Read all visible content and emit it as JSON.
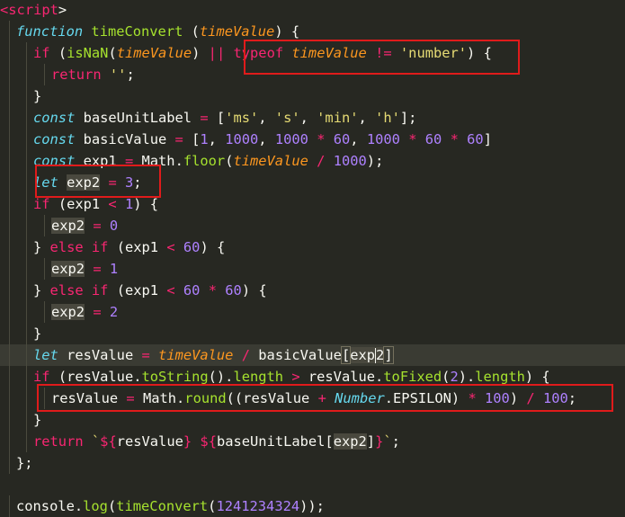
{
  "editor": {
    "colors": {
      "background": "#272822",
      "keyword": "#f92672",
      "storage": "#66d9ef",
      "function": "#a6e22e",
      "parameter": "#fd971f",
      "string": "#e6db74",
      "number": "#ae81ff",
      "annotation_box": "#e01b1b"
    },
    "lines": [
      {
        "indent": 0,
        "tokens": [
          [
            "tag",
            "<"
          ],
          [
            "tag",
            "script"
          ],
          [
            "p",
            ">"
          ]
        ]
      },
      {
        "indent": 1,
        "tokens": [
          [
            "ikw",
            "function"
          ],
          [
            "p",
            " "
          ],
          [
            "fn",
            "timeConvert"
          ],
          [
            "p",
            " ("
          ],
          [
            "param",
            "timeValue"
          ],
          [
            "p",
            ") {"
          ]
        ]
      },
      {
        "indent": 2,
        "tokens": [
          [
            "kw",
            "if"
          ],
          [
            "p",
            " ("
          ],
          [
            "fn",
            "isNaN"
          ],
          [
            "p",
            "("
          ],
          [
            "param",
            "timeValue"
          ],
          [
            "p",
            ") "
          ],
          [
            "op",
            "||"
          ],
          [
            "p",
            " "
          ],
          [
            "kw",
            "typeof"
          ],
          [
            "p",
            " "
          ],
          [
            "param",
            "timeValue"
          ],
          [
            "p",
            " "
          ],
          [
            "op",
            "!="
          ],
          [
            "p",
            " "
          ],
          [
            "str",
            "'number'"
          ],
          [
            "p",
            ") {"
          ]
        ]
      },
      {
        "indent": 3,
        "tokens": [
          [
            "kw",
            "return"
          ],
          [
            "p",
            " "
          ],
          [
            "str",
            "''"
          ],
          [
            "p",
            ";"
          ]
        ]
      },
      {
        "indent": 2,
        "tokens": [
          [
            "p",
            "}"
          ]
        ]
      },
      {
        "indent": 2,
        "tokens": [
          [
            "ikw",
            "const"
          ],
          [
            "p",
            " baseUnitLabel "
          ],
          [
            "op",
            "="
          ],
          [
            "p",
            " ["
          ],
          [
            "str",
            "'ms'"
          ],
          [
            "p",
            ", "
          ],
          [
            "str",
            "'s'"
          ],
          [
            "p",
            ", "
          ],
          [
            "str",
            "'min'"
          ],
          [
            "p",
            ", "
          ],
          [
            "str",
            "'h'"
          ],
          [
            "p",
            "];"
          ]
        ]
      },
      {
        "indent": 2,
        "tokens": [
          [
            "ikw",
            "const"
          ],
          [
            "p",
            " basicValue "
          ],
          [
            "op",
            "="
          ],
          [
            "p",
            " ["
          ],
          [
            "num",
            "1"
          ],
          [
            "p",
            ", "
          ],
          [
            "num",
            "1000"
          ],
          [
            "p",
            ", "
          ],
          [
            "num",
            "1000"
          ],
          [
            "p",
            " "
          ],
          [
            "op",
            "*"
          ],
          [
            "p",
            " "
          ],
          [
            "num",
            "60"
          ],
          [
            "p",
            ", "
          ],
          [
            "num",
            "1000"
          ],
          [
            "p",
            " "
          ],
          [
            "op",
            "*"
          ],
          [
            "p",
            " "
          ],
          [
            "num",
            "60"
          ],
          [
            "p",
            " "
          ],
          [
            "op",
            "*"
          ],
          [
            "p",
            " "
          ],
          [
            "num",
            "60"
          ],
          [
            "p",
            "]"
          ]
        ]
      },
      {
        "indent": 2,
        "tokens": [
          [
            "ikw",
            "const"
          ],
          [
            "p",
            " exp1 "
          ],
          [
            "op",
            "="
          ],
          [
            "p",
            " Math."
          ],
          [
            "fn",
            "floor"
          ],
          [
            "p",
            "("
          ],
          [
            "param",
            "timeValue"
          ],
          [
            "p",
            " "
          ],
          [
            "op",
            "/"
          ],
          [
            "p",
            " "
          ],
          [
            "num",
            "1000"
          ],
          [
            "p",
            ");"
          ]
        ]
      },
      {
        "indent": 2,
        "tokens": [
          [
            "ikw",
            "let"
          ],
          [
            "p",
            " "
          ],
          [
            "sel",
            "exp2"
          ],
          [
            "p",
            " "
          ],
          [
            "op",
            "="
          ],
          [
            "p",
            " "
          ],
          [
            "num",
            "3"
          ],
          [
            "p",
            ";"
          ]
        ]
      },
      {
        "indent": 2,
        "tokens": [
          [
            "kw",
            "if"
          ],
          [
            "p",
            " (exp1 "
          ],
          [
            "op",
            "<"
          ],
          [
            "p",
            " "
          ],
          [
            "num",
            "1"
          ],
          [
            "p",
            ") {"
          ]
        ]
      },
      {
        "indent": 3,
        "tokens": [
          [
            "sel",
            "exp2"
          ],
          [
            "p",
            " "
          ],
          [
            "op",
            "="
          ],
          [
            "p",
            " "
          ],
          [
            "num",
            "0"
          ]
        ]
      },
      {
        "indent": 2,
        "tokens": [
          [
            "p",
            "} "
          ],
          [
            "kw",
            "else"
          ],
          [
            "p",
            " "
          ],
          [
            "kw",
            "if"
          ],
          [
            "p",
            " (exp1 "
          ],
          [
            "op",
            "<"
          ],
          [
            "p",
            " "
          ],
          [
            "num",
            "60"
          ],
          [
            "p",
            ") {"
          ]
        ]
      },
      {
        "indent": 3,
        "tokens": [
          [
            "sel",
            "exp2"
          ],
          [
            "p",
            " "
          ],
          [
            "op",
            "="
          ],
          [
            "p",
            " "
          ],
          [
            "num",
            "1"
          ]
        ]
      },
      {
        "indent": 2,
        "tokens": [
          [
            "p",
            "} "
          ],
          [
            "kw",
            "else"
          ],
          [
            "p",
            " "
          ],
          [
            "kw",
            "if"
          ],
          [
            "p",
            " (exp1 "
          ],
          [
            "op",
            "<"
          ],
          [
            "p",
            " "
          ],
          [
            "num",
            "60"
          ],
          [
            "p",
            " "
          ],
          [
            "op",
            "*"
          ],
          [
            "p",
            " "
          ],
          [
            "num",
            "60"
          ],
          [
            "p",
            ") {"
          ]
        ]
      },
      {
        "indent": 3,
        "tokens": [
          [
            "sel",
            "exp2"
          ],
          [
            "p",
            " "
          ],
          [
            "op",
            "="
          ],
          [
            "p",
            " "
          ],
          [
            "num",
            "2"
          ]
        ]
      },
      {
        "indent": 2,
        "tokens": [
          [
            "p",
            "}"
          ]
        ]
      },
      {
        "indent": 2,
        "current": true,
        "tokens": [
          [
            "ikw",
            "let"
          ],
          [
            "p",
            " resValue "
          ],
          [
            "op",
            "="
          ],
          [
            "p",
            " "
          ],
          [
            "param",
            "timeValue"
          ],
          [
            "p",
            " "
          ],
          [
            "op",
            "/"
          ],
          [
            "p",
            " basicValue"
          ],
          [
            "bm",
            "["
          ],
          [
            "sel",
            "exp2"
          ],
          [
            "bm",
            "]"
          ]
        ]
      },
      {
        "indent": 2,
        "tokens": [
          [
            "kw",
            "if"
          ],
          [
            "p",
            " (resValue."
          ],
          [
            "fn",
            "toString"
          ],
          [
            "p",
            "()."
          ],
          [
            "fn",
            "length"
          ],
          [
            "p",
            " "
          ],
          [
            "op",
            ">"
          ],
          [
            "p",
            " resValue."
          ],
          [
            "fn",
            "toFixed"
          ],
          [
            "p",
            "("
          ],
          [
            "num",
            "2"
          ],
          [
            "p",
            ")."
          ],
          [
            "fn",
            "length"
          ],
          [
            "p",
            ") {"
          ]
        ]
      },
      {
        "indent": 3,
        "tokens": [
          [
            "p",
            "resValue "
          ],
          [
            "op",
            "="
          ],
          [
            "p",
            " Math."
          ],
          [
            "fn",
            "round"
          ],
          [
            "p",
            "((resValue "
          ],
          [
            "op",
            "+"
          ],
          [
            "p",
            " "
          ],
          [
            "ikw",
            "Number"
          ],
          [
            "p",
            "."
          ],
          [
            "p",
            "EPSILON"
          ],
          [
            "p",
            ") "
          ],
          [
            "op",
            "*"
          ],
          [
            "p",
            " "
          ],
          [
            "num",
            "100"
          ],
          [
            "p",
            ") "
          ],
          [
            "op",
            "/"
          ],
          [
            "p",
            " "
          ],
          [
            "num",
            "100"
          ],
          [
            "p",
            ";"
          ]
        ]
      },
      {
        "indent": 2,
        "tokens": [
          [
            "p",
            "}"
          ]
        ]
      },
      {
        "indent": 2,
        "tokens": [
          [
            "kw",
            "return"
          ],
          [
            "p",
            " "
          ],
          [
            "str",
            "`"
          ],
          [
            "kw",
            "${"
          ],
          [
            "p",
            "resValue"
          ],
          [
            "kw",
            "}"
          ],
          [
            "str",
            " "
          ],
          [
            "kw",
            "${"
          ],
          [
            "p",
            "baseUnitLabel["
          ],
          [
            "sel",
            "exp2"
          ],
          [
            "p",
            "]"
          ],
          [
            "kw",
            "}"
          ],
          [
            "str",
            "`"
          ],
          [
            "p",
            ";"
          ]
        ]
      },
      {
        "indent": 1,
        "tokens": [
          [
            "p",
            "};"
          ]
        ]
      },
      {
        "indent": 0,
        "tokens": []
      },
      {
        "indent": 1,
        "tokens": [
          [
            "p",
            "console."
          ],
          [
            "fn",
            "log"
          ],
          [
            "p",
            "("
          ],
          [
            "fn",
            "timeConvert"
          ],
          [
            "p",
            "("
          ],
          [
            "num",
            "1241234324"
          ],
          [
            "p",
            "));"
          ]
        ]
      }
    ]
  }
}
